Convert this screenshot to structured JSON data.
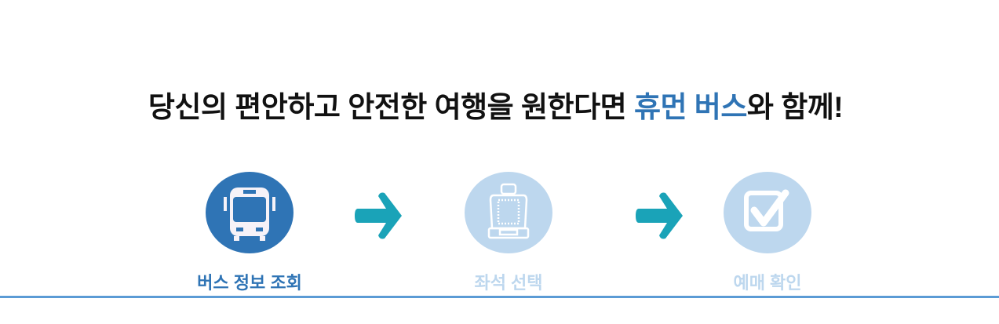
{
  "headline": {
    "prefix": "당신의 편안하고 안전한 여행을 원한다면 ",
    "brand": "휴먼 버스",
    "suffix": "와 함께!"
  },
  "steps": [
    {
      "label": "버스 정보 조회",
      "icon": "bus-icon",
      "active": true
    },
    {
      "label": "좌석 선택",
      "icon": "seat-icon",
      "active": false
    },
    {
      "label": "예매 확인",
      "icon": "checkbox-icon",
      "active": false
    }
  ],
  "colors": {
    "active": "#2f74b5",
    "inactive": "#bdd7ee",
    "arrow": "#1aa3b8",
    "rule": "#5b9bd5",
    "brand": "#2f74b5"
  }
}
